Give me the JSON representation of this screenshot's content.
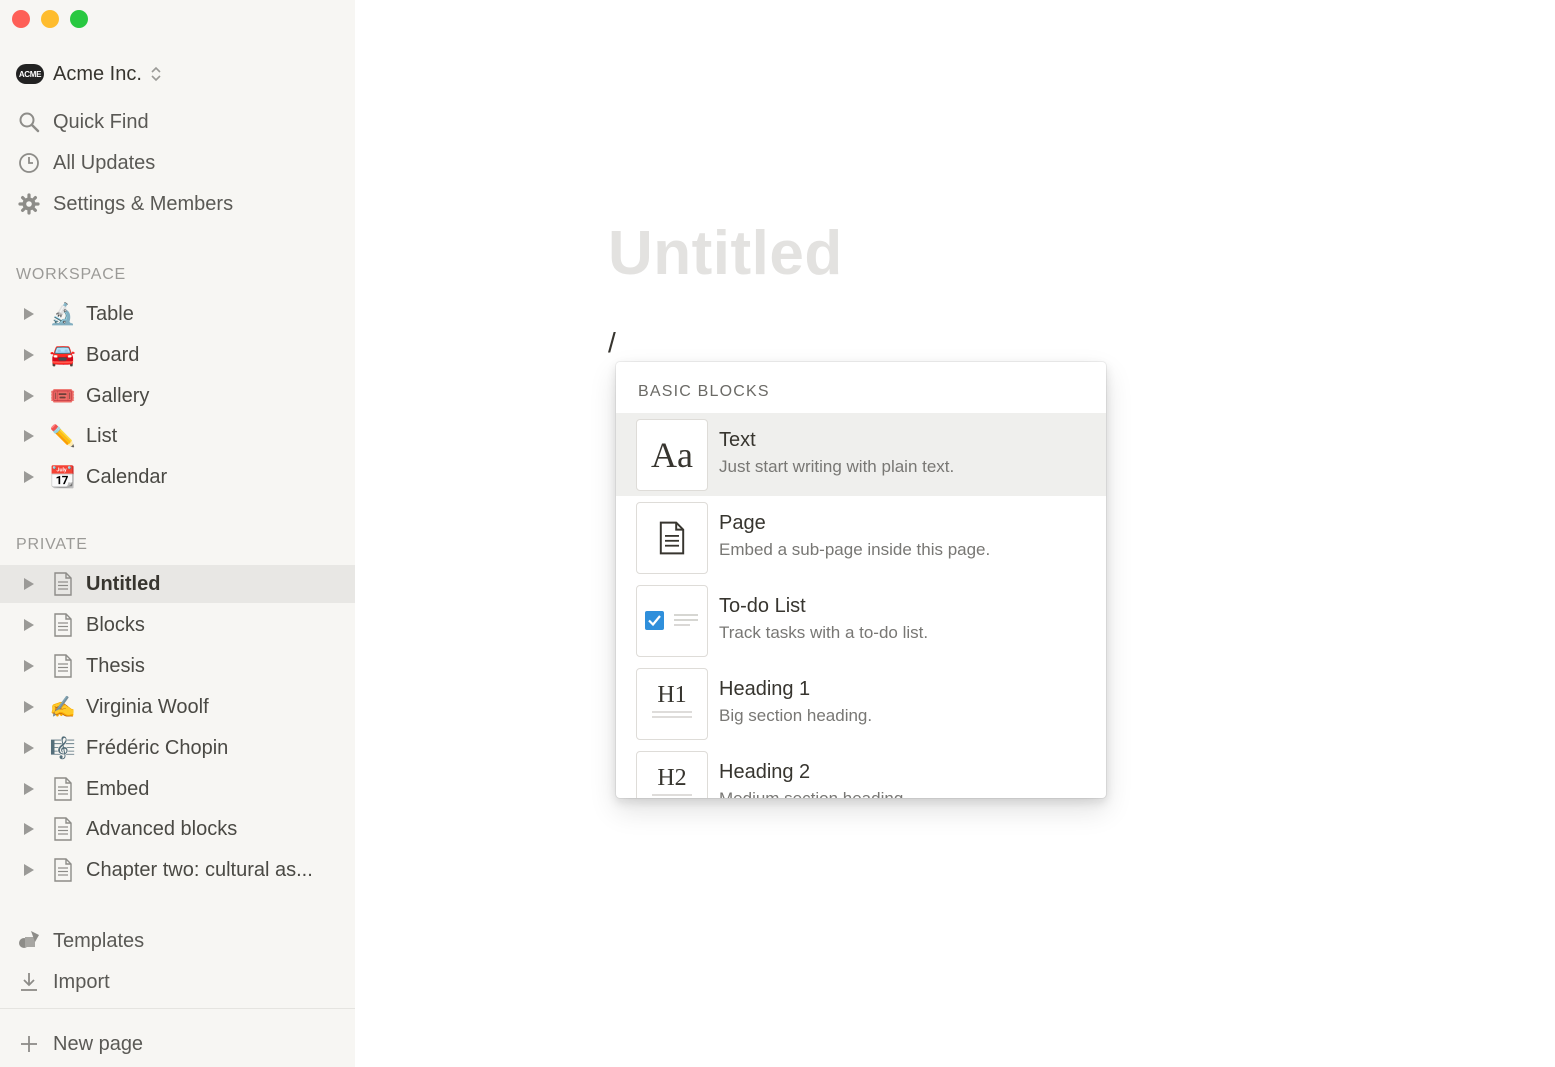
{
  "workspace": {
    "logo_text": "ACME",
    "name": "Acme Inc."
  },
  "nav": [
    {
      "label": "Quick Find",
      "icon": "search-icon"
    },
    {
      "label": "All Updates",
      "icon": "clock-icon"
    },
    {
      "label": "Settings & Members",
      "icon": "gear-icon"
    }
  ],
  "sections": {
    "workspace": "WORKSPACE",
    "private": "PRIVATE"
  },
  "workspace_pages": [
    {
      "label": "Table",
      "icon": "🔬"
    },
    {
      "label": "Board",
      "icon": "🚘"
    },
    {
      "label": "Gallery",
      "icon": "🎟️"
    },
    {
      "label": "List",
      "icon": "✏️"
    },
    {
      "label": "Calendar",
      "icon": "📆"
    }
  ],
  "private_pages": [
    {
      "label": "Untitled",
      "icon": "page-icon",
      "selected": true
    },
    {
      "label": "Blocks",
      "icon": "page-icon"
    },
    {
      "label": "Thesis",
      "icon": "page-icon"
    },
    {
      "label": "Virginia Woolf",
      "icon": "✍️"
    },
    {
      "label": "Frédéric Chopin",
      "icon": "🎼"
    },
    {
      "label": "Embed",
      "icon": "page-icon"
    },
    {
      "label": "Advanced blocks",
      "icon": "page-icon"
    },
    {
      "label": "Chapter two: cultural as...",
      "icon": "page-icon"
    }
  ],
  "footer_nav": [
    {
      "label": "Templates",
      "icon": "templates-icon"
    },
    {
      "label": "Import",
      "icon": "import-icon"
    }
  ],
  "new_page": "New page",
  "main": {
    "title_placeholder": "Untitled",
    "slash": "/"
  },
  "popup": {
    "section": "BASIC BLOCKS",
    "blocks": [
      {
        "title": "Text",
        "desc": "Just start writing with plain text.",
        "thumb": "Aa",
        "active": true
      },
      {
        "title": "Page",
        "desc": "Embed a sub-page inside this page."
      },
      {
        "title": "To-do List",
        "desc": "Track tasks with a to-do list."
      },
      {
        "title": "Heading 1",
        "desc": "Big section heading.",
        "thumb": "H1"
      },
      {
        "title": "Heading 2",
        "desc": "Medium section heading.",
        "thumb": "H2"
      }
    ]
  },
  "colors": {
    "sidebar_bg": "#f7f6f3",
    "selected_bg": "#e8e7e4",
    "checkbox_blue": "#2f8fdb"
  }
}
